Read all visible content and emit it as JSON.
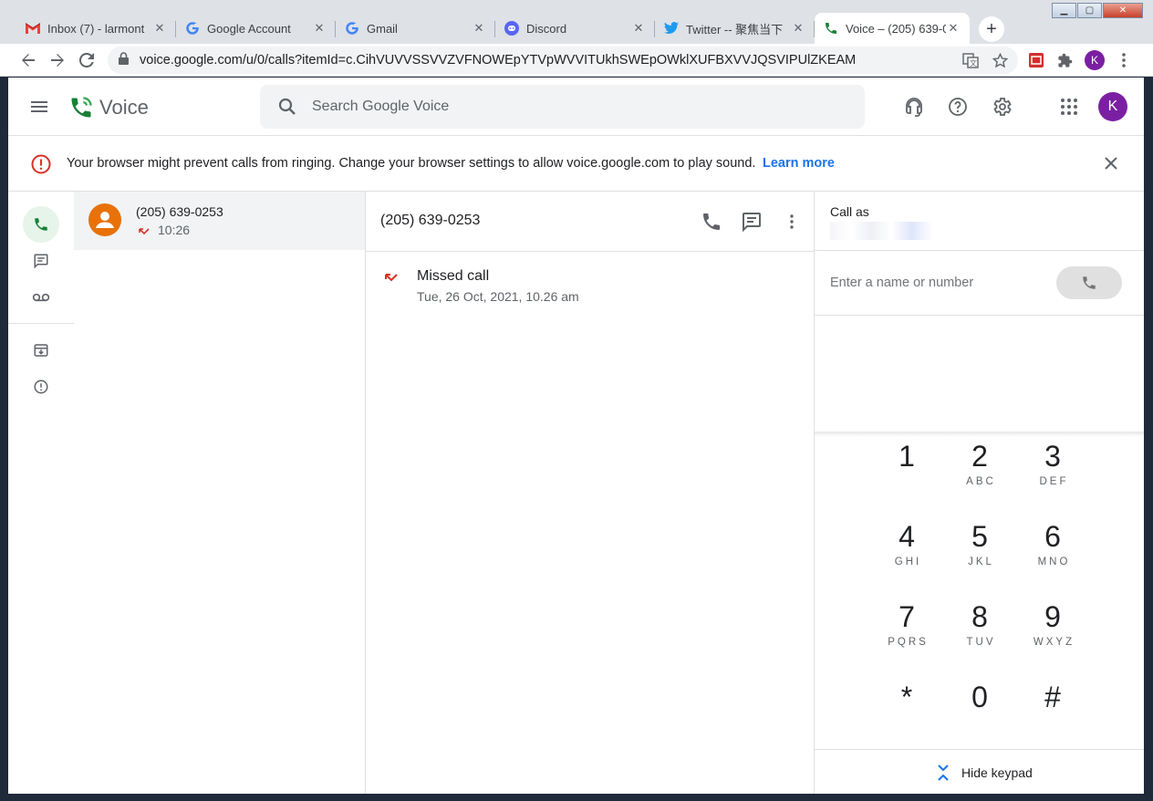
{
  "browser": {
    "tabs": [
      {
        "title": "Inbox (7) - larmont",
        "icon": "gmail-icon"
      },
      {
        "title": "Google Account",
        "icon": "google-icon"
      },
      {
        "title": "Gmail",
        "icon": "google-icon"
      },
      {
        "title": "Discord",
        "icon": "discord-icon"
      },
      {
        "title": "Twitter -- 聚焦当下",
        "icon": "twitter-icon"
      },
      {
        "title": "Voice – (205) 639-0",
        "icon": "voice-icon",
        "active": true
      }
    ],
    "url": "voice.google.com/u/0/calls?itemId=c.CihVUVVSSVVZVFNOWEpYTVpWVVITUkhSWEpOWklXUFBXVVJQSVIPUlZKEAM",
    "profile_initial": "K"
  },
  "app": {
    "name": "Voice",
    "search_placeholder": "Search Google Voice",
    "avatar_initial": "K",
    "banner": {
      "message": "Your browser might prevent calls from ringing. Change your browser settings to allow voice.google.com to play sound.",
      "link": "Learn more"
    }
  },
  "call_list": [
    {
      "number": "(205) 639-0253",
      "time": "10:26",
      "status": "missed"
    }
  ],
  "detail": {
    "title": "(205) 639-0253",
    "entries": [
      {
        "title": "Missed call",
        "date": "Tue, 26 Oct, 2021, 10.26 am"
      }
    ]
  },
  "dialer": {
    "call_as_label": "Call as",
    "input_placeholder": "Enter a name or number",
    "keys": [
      {
        "digit": "1",
        "letters": ""
      },
      {
        "digit": "2",
        "letters": "ABC"
      },
      {
        "digit": "3",
        "letters": "DEF"
      },
      {
        "digit": "4",
        "letters": "GHI"
      },
      {
        "digit": "5",
        "letters": "JKL"
      },
      {
        "digit": "6",
        "letters": "MNO"
      },
      {
        "digit": "7",
        "letters": "PQRS"
      },
      {
        "digit": "8",
        "letters": "TUV"
      },
      {
        "digit": "9",
        "letters": "WXYZ"
      },
      {
        "digit": "*",
        "letters": ""
      },
      {
        "digit": "0",
        "letters": ""
      },
      {
        "digit": "#",
        "letters": ""
      }
    ],
    "hide_keypad": "Hide keypad"
  },
  "colors": {
    "accent_green": "#188038",
    "missed_red": "#d93025",
    "link_blue": "#1a73e8",
    "avatar_purple": "#7b1fa2",
    "contact_orange": "#e8710a"
  }
}
